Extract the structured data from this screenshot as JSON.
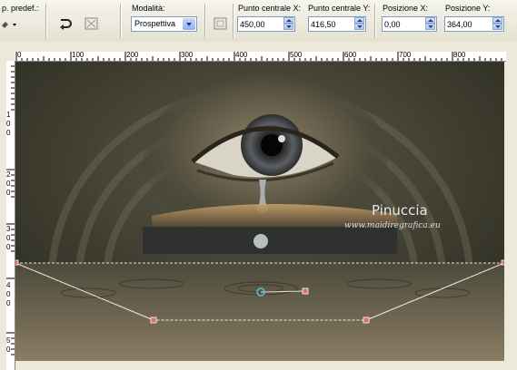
{
  "toolbar": {
    "preset_label": "p. predef.:",
    "mode_label": "Modalità:",
    "mode_value": "Prospettiva",
    "center_x_label": "Punto centrale X:",
    "center_x_value": "450,00",
    "center_y_label": "Punto centrale Y:",
    "center_y_value": "416,50",
    "pos_x_label": "Posizione X:",
    "pos_x_value": "0,00",
    "pos_y_label": "Posizione Y:",
    "pos_y_value": "364,00"
  },
  "ruler": {
    "top_ticks": [
      "0",
      "100",
      "200",
      "300",
      "400",
      "500",
      "600",
      "700",
      "800"
    ],
    "left_ticks": [
      "1",
      "0",
      "0",
      "2",
      "0",
      "0",
      "3",
      "0",
      "0",
      "4",
      "0",
      "0",
      "5",
      "0"
    ]
  },
  "canvas": {
    "watermark_title": "Pinuccia",
    "watermark_url": "www.maidiregrafica.eu"
  }
}
